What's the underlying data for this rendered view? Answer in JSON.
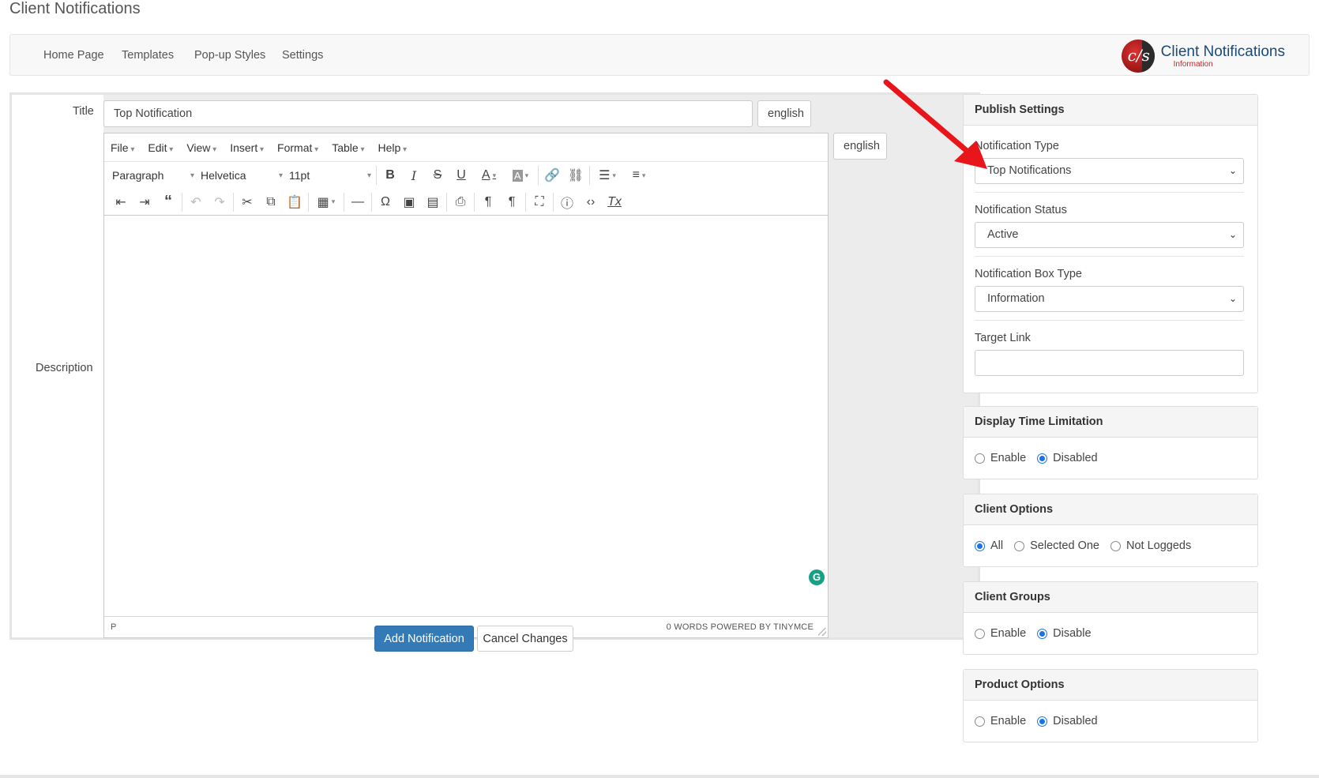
{
  "page_title": "Client Notifications",
  "nav": {
    "items": [
      "Home Page",
      "Templates",
      "Pop-up Styles",
      "Settings"
    ],
    "brand_name": "Client Notifications",
    "brand_sub": "Information"
  },
  "form": {
    "title_label": "Title",
    "title_value": "Top Notification",
    "title_lang": "english",
    "description_label": "Description",
    "description_lang": "english"
  },
  "editor": {
    "menus": [
      "File",
      "Edit",
      "View",
      "Insert",
      "Format",
      "Table",
      "Help"
    ],
    "block_format": "Paragraph",
    "font_family": "Helvetica",
    "font_size": "11pt",
    "status_path": "P",
    "status_info": "0 WORDS POWERED BY TINYMCE",
    "grammarly_glyph": "G"
  },
  "actions": {
    "add": "Add Notification",
    "cancel": "Cancel Changes"
  },
  "publish": {
    "heading": "Publish Settings",
    "type_label": "Notification Type",
    "type_value": "Top Notifications",
    "status_label": "Notification Status",
    "status_value": "Active",
    "box_label": "Notification Box Type",
    "box_value": "Information",
    "link_label": "Target Link"
  },
  "display_time": {
    "heading": "Display Time Limitation",
    "options": [
      "Enable",
      "Disabled"
    ]
  },
  "client_options": {
    "heading": "Client Options",
    "options": [
      "All",
      "Selected One",
      "Not Loggeds"
    ]
  },
  "client_groups": {
    "heading": "Client Groups",
    "options": [
      "Enable",
      "Disable"
    ]
  },
  "product_options": {
    "heading": "Product Options",
    "options": [
      "Enable",
      "Disabled"
    ]
  },
  "colors": {
    "primary": "#337ab7",
    "annotation_arrow": "#e8161b"
  }
}
